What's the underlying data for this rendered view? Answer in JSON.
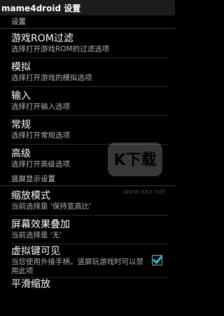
{
  "titlebar": {
    "title": "mame4droid 设置"
  },
  "sections": [
    {
      "label": "设置",
      "items": [
        {
          "title": "游戏ROM过滤",
          "subtitle": "选择打开游戏ROM的过滤选项"
        },
        {
          "title": "模拟",
          "subtitle": "选择打开游戏的模拟选项"
        },
        {
          "title": "输入",
          "subtitle": "选择打开输入选项"
        },
        {
          "title": "常规",
          "subtitle": "选择打开常规选项"
        },
        {
          "title": "高级",
          "subtitle": "选择打开高级选项"
        }
      ]
    },
    {
      "label": "竖屏显示设置",
      "items": [
        {
          "title": "缩放模式",
          "subtitle": "当前选择是 '保持宽高比'"
        },
        {
          "title": "屏幕效果叠加",
          "subtitle": "当前选择是 '无'"
        },
        {
          "title": "虚拟键可见",
          "subtitle": "当您使用外接手柄，竖屏玩游戏时可以禁用此项",
          "checked": true
        },
        {
          "title": "平滑缩放"
        }
      ]
    }
  ],
  "watermark": {
    "url": "www.kkx.net",
    "text": "K下载"
  },
  "colors": {
    "accent": "#33b5e5",
    "background": "#000000"
  }
}
